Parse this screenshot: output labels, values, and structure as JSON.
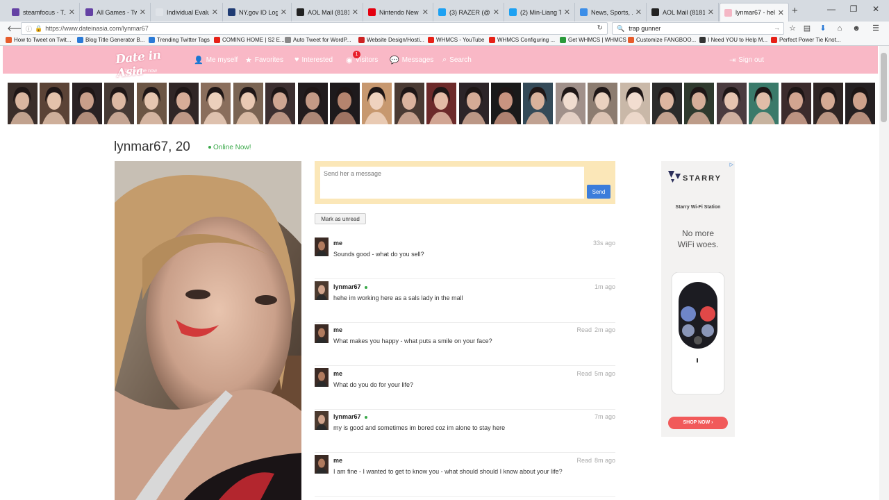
{
  "browser": {
    "tabs": [
      {
        "label": "steamfocus - T...",
        "color": "#6441a4"
      },
      {
        "label": "All Games - Twi...",
        "color": "#6441a4"
      },
      {
        "label": "Individual Evaluatio...",
        "color": "#dfe3e8"
      },
      {
        "label": "NY.gov ID Login",
        "color": "#1f3b73"
      },
      {
        "label": "AOL Mail (8181)",
        "color": "#222222"
      },
      {
        "label": "Nintendo New ...",
        "color": "#e4000f"
      },
      {
        "label": "(3) RAZER (@Ra...",
        "color": "#1da1f2"
      },
      {
        "label": "(2) Min-Liang T...",
        "color": "#1da1f2"
      },
      {
        "label": "News, Sports, ...",
        "color": "#3c8ee8"
      },
      {
        "label": "AOL Mail (8181)",
        "color": "#222222"
      },
      {
        "label": "lynmar67 - hell...",
        "color": "#f4b7c5"
      }
    ],
    "new_tab": "+",
    "url": "https://www.dateinasia.com/lynmar67",
    "search_query": "trap gunner",
    "bookmarks": [
      {
        "label": "How to Tweet on Twit...",
        "color": "#e65c2b"
      },
      {
        "label": "Blog Title Generator B...",
        "color": "#2a7ad6"
      },
      {
        "label": "Trending Twitter Tags",
        "color": "#2a7ad6"
      },
      {
        "label": "COMING HOME | S2 E...",
        "color": "#e62117"
      },
      {
        "label": "Auto Tweet for WordP...",
        "color": "#888888"
      },
      {
        "label": "Website Design/Hosti...",
        "color": "#cc2222"
      },
      {
        "label": "WHMCS - YouTube",
        "color": "#e62117"
      },
      {
        "label": "WHMCS Configuring ...",
        "color": "#e62117"
      },
      {
        "label": "Get WHMCS | WHMCS",
        "color": "#2a9a3a"
      },
      {
        "label": "Customize FANGBOO...",
        "color": "#e65c2b"
      },
      {
        "label": "I Need YOU to Help M...",
        "color": "#333333"
      },
      {
        "label": "Perfect Power Tie Knot...",
        "color": "#e62117"
      }
    ]
  },
  "site": {
    "logo_text": "Date in Asia",
    "online_count": "6 723 online now",
    "nav": {
      "me_myself": "Me myself",
      "favorites": "Favorites",
      "interested": "Interested",
      "visitors": "Visitors",
      "visitors_badge": "1",
      "messages": "Messages",
      "search": "Search",
      "sign_out": "Sign out"
    },
    "accent_color": "#f9b8c6"
  },
  "profile": {
    "title": "lynmar67, 20",
    "online_status": "Online Now!",
    "composer_placeholder": "Send her a message",
    "send_label": "Send",
    "mark_unread_label": "Mark as unread"
  },
  "messages": [
    {
      "sender": "me",
      "online": false,
      "text": "Sounds good - what do you sell?",
      "read": "",
      "time": "33s ago"
    },
    {
      "sender": "lynmar67",
      "online": true,
      "text": "hehe im working here as a sals lady in the mall",
      "read": "",
      "time": "1m ago"
    },
    {
      "sender": "me",
      "online": false,
      "text": "What makes you happy - what puts a smile on your face?",
      "read": "Read",
      "time": "2m ago"
    },
    {
      "sender": "me",
      "online": false,
      "text": "What do you do for your life?",
      "read": "Read",
      "time": "5m ago"
    },
    {
      "sender": "lynmar67",
      "online": true,
      "text": "my is good and sometimes im bored coz im alone to stay here",
      "read": "",
      "time": "7m ago"
    },
    {
      "sender": "me",
      "online": false,
      "text": "I am fine - I wanted to get to know you - what should should I know about your life?",
      "read": "Read",
      "time": "8m ago"
    }
  ],
  "ad": {
    "brand": "STARRY",
    "subtitle": "Starry Wi-Fi Station",
    "tagline_line1": "No more",
    "tagline_line2": "WiFi woes.",
    "cta": "SHOP NOW ›",
    "adchoices": "▷"
  }
}
